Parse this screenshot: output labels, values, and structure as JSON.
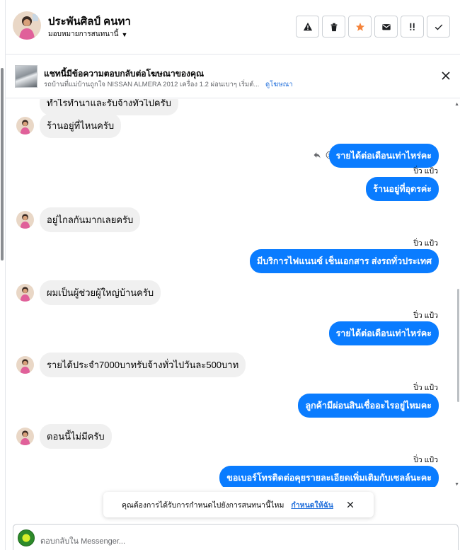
{
  "header": {
    "name": "ประพันศิลป์ คนทา",
    "assign_label": "มอบหมายการสนทนานี้",
    "actions": [
      {
        "icon": "warning-icon"
      },
      {
        "icon": "trash-icon"
      },
      {
        "icon": "star-icon"
      },
      {
        "icon": "mail-icon"
      },
      {
        "icon": "priority-icon"
      },
      {
        "icon": "check-icon"
      }
    ]
  },
  "ad_banner": {
    "title": "แชทนี้มีข้อความตอบกลับต่อโฆษณาของคุณ",
    "subtitle": "รถบ้านที่แม่บ้านถูกใจ NISSAN ALMERA 2012 เครื่อง 1.2 ผ่อนเบาๆ เริ่มต์...",
    "link": "ดูโฆษณา"
  },
  "messages": [
    {
      "side": "in",
      "text": "ทำไรทำนาและรับจ้างทั่วไปครับ"
    },
    {
      "side": "in",
      "text": "ร้านอยู่ที่ไหนครับ"
    },
    {
      "side": "out",
      "text": "รายได้ต่อเดือนเท่าไหร่คะ"
    },
    {
      "side": "seen",
      "text": "ปิ่ว แป้ว"
    },
    {
      "side": "out",
      "text": "ร้านอยู่ที่อุดรค่ะ"
    },
    {
      "side": "in",
      "text": "อยู่ไกลกันมากเลยครับ"
    },
    {
      "side": "seen",
      "text": "ปิ่ว แป้ว"
    },
    {
      "side": "out",
      "text": "มีบริการไฟแนนซ์ เช็นเอกสาร ส่งรถทั่วประเทศ"
    },
    {
      "side": "in",
      "text": "ผมเป็นผู้ช่วยผู้ใหญ่บ้านครับ"
    },
    {
      "side": "seen",
      "text": "ปิ่ว แป้ว"
    },
    {
      "side": "out",
      "text": "รายได้ต่อเดือนเท่าไหร่คะ"
    },
    {
      "side": "in",
      "text": "รายได้ประจำ7000บาทรับจ้างทั่วไปวันละ500บาท"
    },
    {
      "side": "seen",
      "text": "ปิ่ว แป้ว"
    },
    {
      "side": "out",
      "text": "ลูกค้ามีผ่อนสินเชื่ออะไรอยู่ไหมคะ"
    },
    {
      "side": "in",
      "text": "ตอนนี้ไม่มีครับ"
    },
    {
      "side": "seen",
      "text": "ปิ่ว แป้ว"
    },
    {
      "side": "out",
      "text": "ขอเบอร์โทรติดต่อคุยรายละเอียดเพิ่มเติมกับเซลล์นะคะ"
    }
  ],
  "toast": {
    "text": "คุณต้องการได้รับการกำหนดไปยังการสนทนานี้ไหม",
    "link": "กำหนดให้ฉัน"
  },
  "composer": {
    "placeholder": "ตอบกลับใน Messenger..."
  },
  "colors": {
    "accent": "#0a7cff",
    "star": "#f5833a",
    "link": "#216fdb"
  }
}
